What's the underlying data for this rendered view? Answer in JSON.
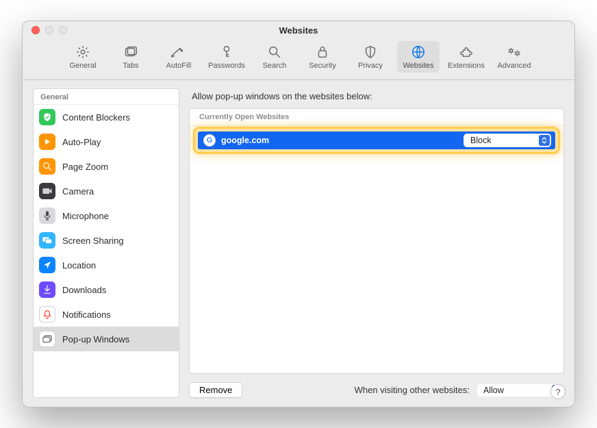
{
  "window_title": "Websites",
  "toolbar": [
    {
      "id": "general",
      "label": "General"
    },
    {
      "id": "tabs",
      "label": "Tabs"
    },
    {
      "id": "autofill",
      "label": "AutoFill"
    },
    {
      "id": "passwords",
      "label": "Passwords"
    },
    {
      "id": "search",
      "label": "Search"
    },
    {
      "id": "security",
      "label": "Security"
    },
    {
      "id": "privacy",
      "label": "Privacy"
    },
    {
      "id": "websites",
      "label": "Websites",
      "selected": true
    },
    {
      "id": "extensions",
      "label": "Extensions"
    },
    {
      "id": "advanced",
      "label": "Advanced"
    }
  ],
  "sidebar": {
    "header": "General",
    "items": [
      {
        "id": "content-blockers",
        "label": "Content Blockers",
        "bg": "#34c759",
        "icon": "shield"
      },
      {
        "id": "autoplay",
        "label": "Auto-Play",
        "bg": "#ff9500",
        "icon": "play"
      },
      {
        "id": "page-zoom",
        "label": "Page Zoom",
        "bg": "#ff9500",
        "icon": "zoom"
      },
      {
        "id": "camera",
        "label": "Camera",
        "bg": "#3a3a3c",
        "icon": "camera"
      },
      {
        "id": "microphone",
        "label": "Microphone",
        "bg": "#d9d9de",
        "icon": "mic"
      },
      {
        "id": "screen-sharing",
        "label": "Screen Sharing",
        "bg": "#32b5ff",
        "icon": "screens"
      },
      {
        "id": "location",
        "label": "Location",
        "bg": "#0a84ff",
        "icon": "arrow"
      },
      {
        "id": "downloads",
        "label": "Downloads",
        "bg": "#6e4bff",
        "icon": "download"
      },
      {
        "id": "notifications",
        "label": "Notifications",
        "bg": "#ffffff",
        "icon": "bell",
        "fg": "#ff3b30",
        "border": true
      },
      {
        "id": "popups",
        "label": "Pop-up Windows",
        "bg": "#ffffff",
        "icon": "windows",
        "fg": "#555",
        "border": true,
        "selected": true
      }
    ]
  },
  "main": {
    "instruction": "Allow pop-up windows on the websites below:",
    "table_header": "Currently Open Websites",
    "rows": [
      {
        "site": "google.com",
        "value": "Block"
      }
    ],
    "remove_label": "Remove",
    "other_label": "When visiting other websites:",
    "other_value": "Allow"
  },
  "help_label": "?"
}
